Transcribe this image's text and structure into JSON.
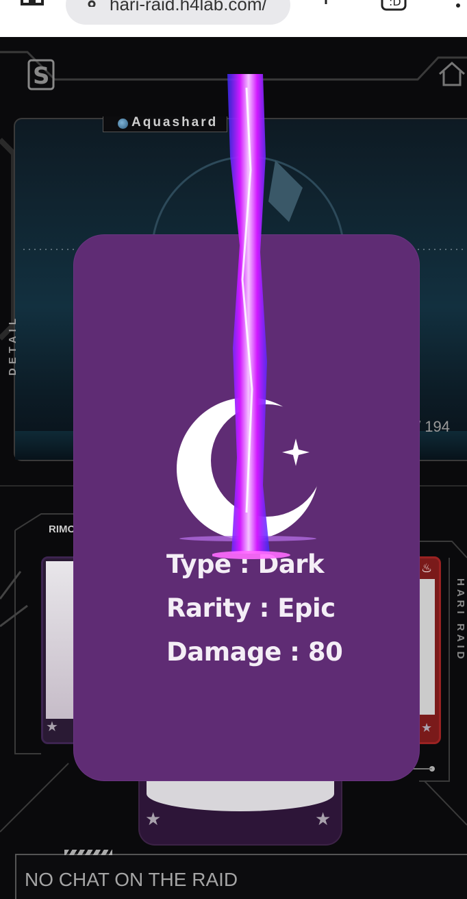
{
  "browser": {
    "url": "hari-raid.h4lab.com/"
  },
  "raid": {
    "boss_name": "Aquashard",
    "hp_counter": "/ 194",
    "detail_label": "DETAIL",
    "side_label": "HARI RAID",
    "player_label": "RIMO",
    "chat_message": "NO CHAT ON THE RAID"
  },
  "card": {
    "icon": "crescent-moon-star-icon",
    "type_text": "Type : Dark",
    "rarity_text": "Rarity : Epic",
    "damage_text": "Damage : 80",
    "background_color": "#5f2c74",
    "beam_color": "#d21bff"
  }
}
